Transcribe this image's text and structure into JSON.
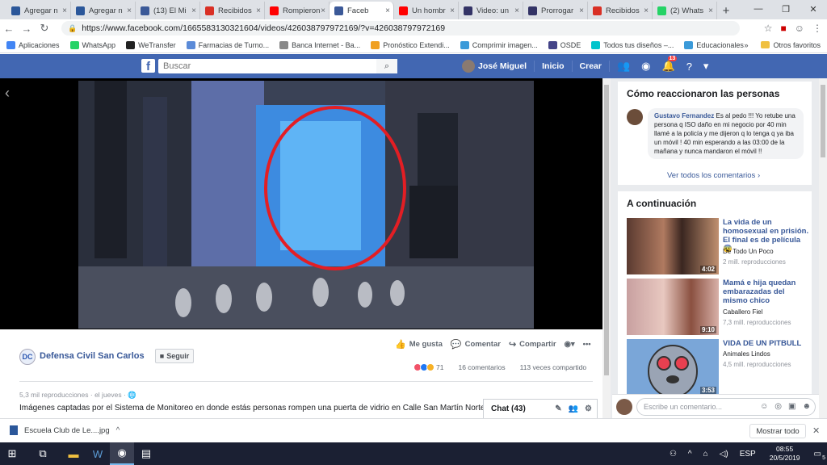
{
  "browser": {
    "tabs": [
      {
        "label": "Agregar n",
        "color": "#2b579a"
      },
      {
        "label": "Agregar n",
        "color": "#2b579a"
      },
      {
        "label": "(13) El Mi",
        "color": "#3b5998"
      },
      {
        "label": "Recibidos",
        "color": "#d93025"
      },
      {
        "label": "Rompieron",
        "color": "#ff0000"
      },
      {
        "label": "Faceb",
        "color": "#3b5998",
        "active": true
      },
      {
        "label": "Un hombr",
        "color": "#ff0000"
      },
      {
        "label": "Video: un",
        "color": "#333366"
      },
      {
        "label": "Prorrogar",
        "color": "#333366"
      },
      {
        "label": "Recibidos",
        "color": "#d93025"
      },
      {
        "label": "(2) Whats",
        "color": "#25d366"
      }
    ],
    "url": "https://www.facebook.com/1665583130321604/videos/426038797972169/?v=426038797972169",
    "bookmarks": [
      {
        "label": "Aplicaciones",
        "color": "#4285f4"
      },
      {
        "label": "WhatsApp",
        "color": "#25d366"
      },
      {
        "label": "WeTransfer",
        "color": "#222222"
      },
      {
        "label": "Farmacias de Turno...",
        "color": "#5b8bd8"
      },
      {
        "label": "Banca Internet - Ba...",
        "color": "#888888"
      },
      {
        "label": "Pronóstico Extendi...",
        "color": "#f0a020"
      },
      {
        "label": "Comprimir imagen...",
        "color": "#3a9ad9"
      },
      {
        "label": "OSDE",
        "color": "#444488"
      },
      {
        "label": "Todos tus diseños –...",
        "color": "#00c4cc"
      },
      {
        "label": "Educacionales",
        "color": "#3b9ad9"
      }
    ],
    "bookmarks_more": "»",
    "other_favorites": "Otros favoritos"
  },
  "facebook": {
    "search_placeholder": "Buscar",
    "user": "José Miguel",
    "nav_home": "Inicio",
    "nav_create": "Crear",
    "notifications_count": "13"
  },
  "post": {
    "page_name": "Defensa Civil San Carlos",
    "follow_label": "Seguir",
    "like_label": "Me gusta",
    "comment_label": "Comentar",
    "share_label": "Compartir",
    "reactions_count": "71",
    "comments_count": "16 comentarios",
    "shares_count": "113 veces compartido",
    "views": "5,3 mil reproducciones",
    "date": "el jueves",
    "caption": "Imágenes captadas por el Sistema de Monitoreo en donde estás personas rompen una puerta de vidrio en Calle San Martín Norte."
  },
  "reactions_panel": {
    "title": "Cómo reaccionaron las personas",
    "comment_author": "Gustavo Fernandez",
    "comment_text": "Es al pedo !!! Yo retube una persona q ISO daño en mi negocio por 40 min llamé a la policía y me dijeron q lo tenga q ya iba un móvil ! 40 min esperando a las 03:00 de la mañana y nunca mandaron el móvil !!",
    "see_all": "Ver todos los comentarios"
  },
  "next_panel": {
    "title": "A continuación",
    "videos": [
      {
        "title": "La vida de un homosexual en prisión. El final es de película 😨",
        "channel": "De Todo Un Poco",
        "views": "2 mill. reproducciones",
        "duration": "4:02"
      },
      {
        "title": "Mamá e hija quedan embarazadas del mismo chico",
        "channel": "Caballero Fiel",
        "views": "7,3 mill. reproducciones",
        "duration": "9:10"
      },
      {
        "title": "VIDA DE UN PITBULL",
        "channel": "Animales Lindos",
        "views": "4,5 mill. reproducciones",
        "duration": "3:53"
      }
    ]
  },
  "chat": {
    "label": "Chat (43)"
  },
  "comment_box": {
    "placeholder": "Escribe un comentario..."
  },
  "download_bar": {
    "file": "Escuela Club de Le....jpg",
    "show_all": "Mostrar todo"
  },
  "taskbar": {
    "lang": "ESP",
    "time": "08:55",
    "date": "20/5/2019",
    "notif_count": "5"
  }
}
